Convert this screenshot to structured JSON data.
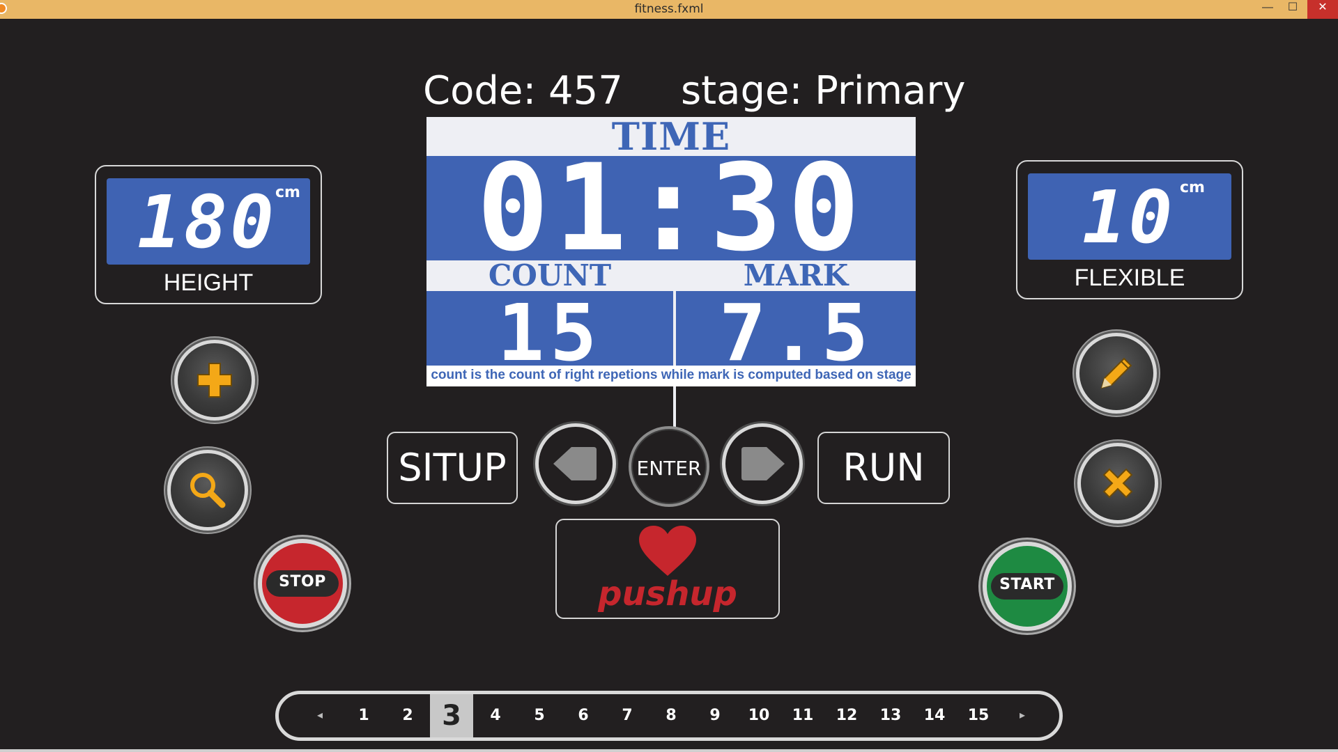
{
  "window": {
    "title": "fitness.fxml",
    "minimize_glyph": "—",
    "maximize_glyph": "☐",
    "close_glyph": "✕"
  },
  "header": {
    "code": "Code: 457",
    "stage": "stage: Primary"
  },
  "board": {
    "time_label": "TIME",
    "time_value": "01:30",
    "count_label": "COUNT",
    "count_value": "15",
    "mark_label": "MARK",
    "mark_value": "7.5",
    "note": "count is the count of right repetions while mark is computed based on stage"
  },
  "height_display": {
    "value": "180",
    "unit": "cm",
    "label": "HEIGHT"
  },
  "flexible_display": {
    "value": "10",
    "unit": "cm",
    "label": "FLEXIBLE"
  },
  "left_buttons": {
    "add_icon": "plus-icon",
    "search_icon": "search-icon",
    "stop_label": "STOP"
  },
  "right_buttons": {
    "edit_icon": "pencil-icon",
    "delete_icon": "x-icon",
    "start_label": "START"
  },
  "nav": {
    "left_exercise": "SITUP",
    "enter_label": "ENTER",
    "right_exercise": "RUN",
    "current_exercise": "pushup"
  },
  "pagination": {
    "prev": "◂",
    "next": "▸",
    "pages": [
      "1",
      "2",
      "3",
      "4",
      "5",
      "6",
      "7",
      "8",
      "9",
      "10",
      "11",
      "12",
      "13",
      "14",
      "15"
    ],
    "active_page": "3"
  },
  "colors": {
    "background": "#221f20",
    "titlebar": "#e9b766",
    "board_blue": "#3f63b3",
    "accent_orange": "#f4a817",
    "stop_red": "#c6262d",
    "start_green": "#1e8a42"
  }
}
